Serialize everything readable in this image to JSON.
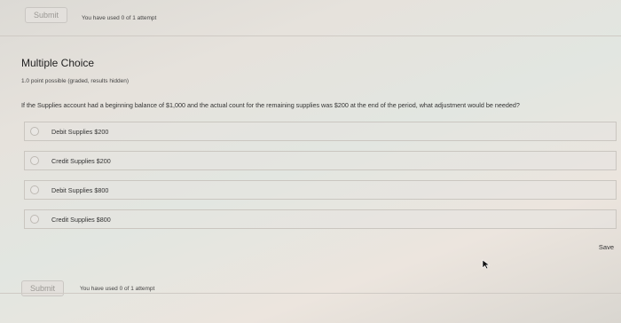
{
  "top": {
    "submit_label": "Submit",
    "attempt_text": "You have used 0 of 1 attempt"
  },
  "section": {
    "title": "Multiple Choice",
    "points": "1.0 point possible (graded, results hidden)"
  },
  "question": {
    "text": "If the Supplies account had a beginning balance of $1,000 and the actual count for the remaining supplies was $200 at the end of the period, what adjustment would be needed?"
  },
  "options": [
    {
      "label": "Debit Supplies $200"
    },
    {
      "label": "Credit Supplies $200"
    },
    {
      "label": "Debit Supplies $800"
    },
    {
      "label": "Credit Supplies $800"
    }
  ],
  "actions": {
    "save_label": "Save"
  },
  "bottom": {
    "submit_label": "Submit",
    "attempt_text": "You have used 0 of 1 attempt"
  }
}
